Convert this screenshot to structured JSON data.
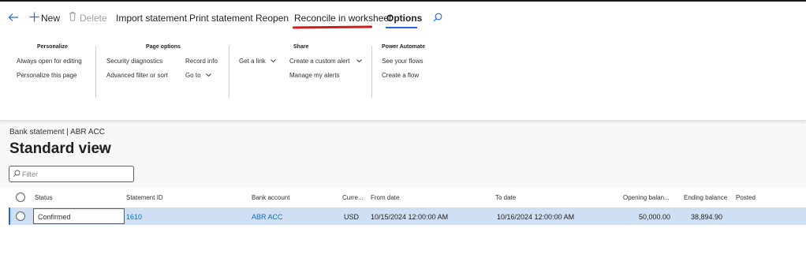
{
  "toolbar": {
    "new_label": "New",
    "delete_label": "Delete",
    "import_label": "Import statement",
    "print_label": "Print statement",
    "reopen_label": "Reopen",
    "reconcile_label": "Reconcile in worksheet",
    "options_label": "Options",
    "accent_color": "#2266e3",
    "annotation_color": "#d11a1a"
  },
  "ribbon": {
    "personalize": {
      "title": "Personalize",
      "always_open": "Always open for editing",
      "personalize_page": "Personalize this page"
    },
    "page_options": {
      "title": "Page options",
      "security": "Security diagnostics",
      "advanced_filter": "Advanced filter or sort",
      "record_info": "Record info",
      "go_to": "Go to"
    },
    "share": {
      "title": "Share",
      "get_link": "Get a link",
      "custom_alert": "Create a custom alert",
      "manage_alerts": "Manage my alerts"
    },
    "power_automate": {
      "title": "Power Automate",
      "see_flows": "See your flows",
      "create_flow": "Create a flow"
    }
  },
  "page": {
    "breadcrumb": "Bank statement  |  ABR ACC",
    "view_title": "Standard view",
    "filter_placeholder": "Filter"
  },
  "grid": {
    "columns": [
      "Status",
      "Statement ID",
      "Bank account",
      "Curre...",
      "From date",
      "To date",
      "Opening balan...",
      "Ending balance",
      "Posted"
    ],
    "rows": [
      {
        "status": "Confirmed",
        "statement_id": "1610",
        "bank_account": "ABR ACC",
        "currency": "USD",
        "from_date": "10/15/2024 12:00:00 AM",
        "to_date": "10/16/2024 12:00:00 AM",
        "opening_balance": "50,000.00",
        "ending_balance": "38,894.90",
        "posted": ""
      }
    ]
  }
}
